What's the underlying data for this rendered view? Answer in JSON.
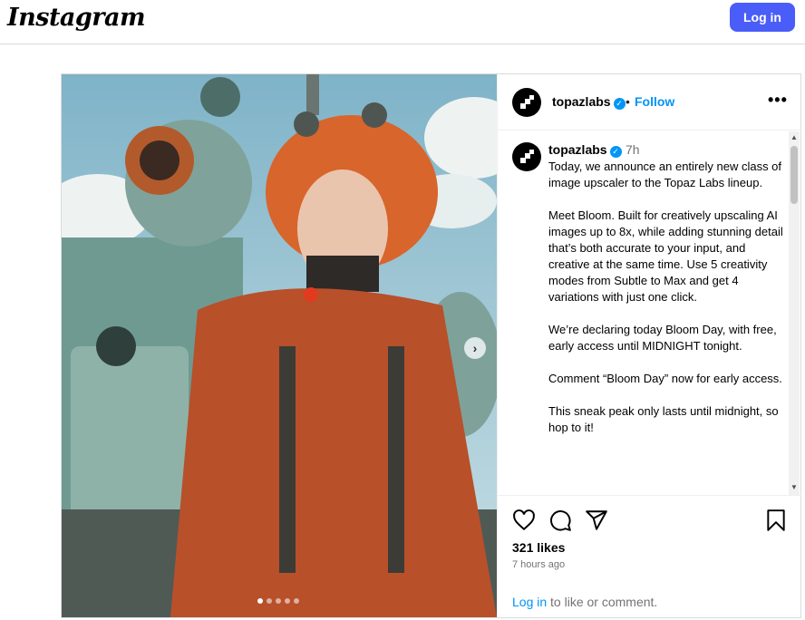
{
  "header": {
    "logo_text": "Instagram",
    "login_label": "Log in"
  },
  "post": {
    "image_alt_icon": "image-next-arrow",
    "carousel_dots": 5,
    "carousel_active": 0,
    "author": {
      "username": "topazlabs",
      "verified": true,
      "follow_label": "Follow",
      "separator": "•"
    },
    "more_label": "•••",
    "caption": {
      "username": "topazlabs",
      "time": "7h",
      "text": "Today, we announce an entirely new class of image upscaler to the Topaz Labs lineup.\n\nMeet Bloom. Built for creatively upscaling AI images up to 8x, while adding stunning detail that’s both accurate to your input, and creative at the same time. Use 5 creativity modes from Subtle to Max and get 4 variations with just one click.\n\nWe’re declaring today Bloom Day, with free, early access until MIDNIGHT tonight.\n\nComment “Bloom Day” now for early access.\n\nThis sneak peak only lasts until midnight, so hop to it!"
    },
    "likes": "321 likes",
    "time_ago": "7 hours ago",
    "login_prompt": {
      "link": "Log in",
      "rest": " to like or comment."
    }
  }
}
